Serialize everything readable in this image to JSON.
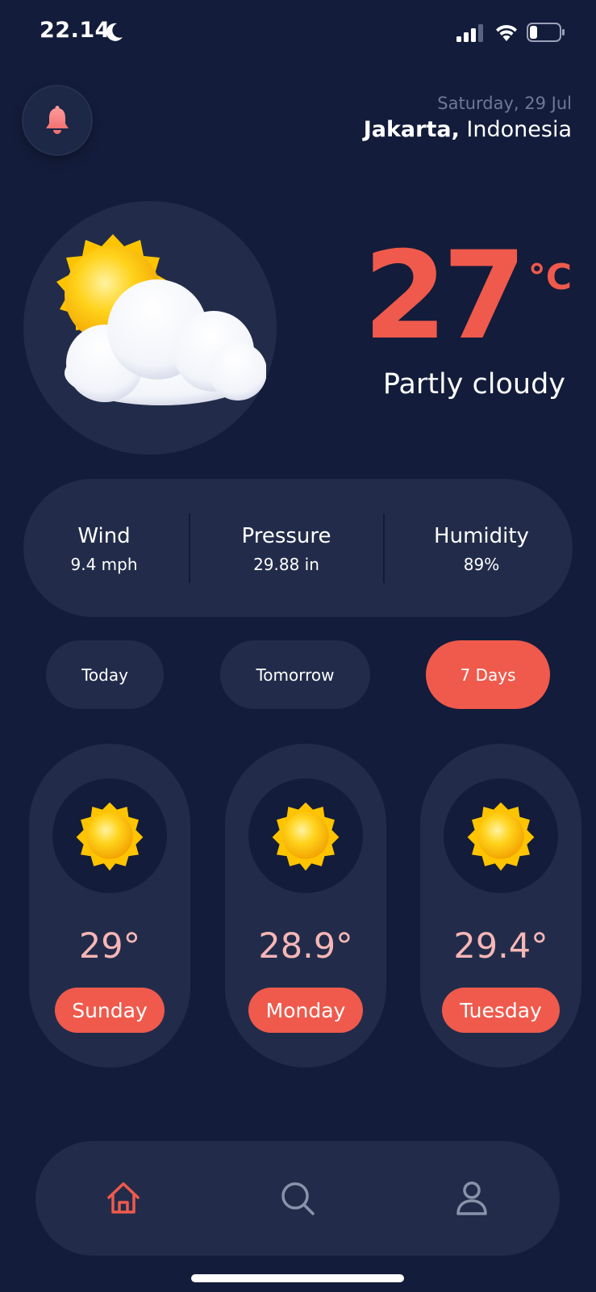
{
  "status_bar": {
    "time": "22.14",
    "icons": [
      "moon-icon",
      "signal-icon",
      "wifi-icon",
      "battery-icon"
    ]
  },
  "header": {
    "bell_icon": "bell-icon",
    "date": "Saturday, 29 Jul",
    "city": "Jakarta,",
    "country": "Indonesia"
  },
  "current": {
    "icon": "partly-cloudy-icon",
    "temperature": "27",
    "unit": "°C",
    "condition": "Partly cloudy"
  },
  "stats": [
    {
      "label": "Wind",
      "value": "9.4 mph"
    },
    {
      "label": "Pressure",
      "value": "29.88 in"
    },
    {
      "label": "Humidity",
      "value": "89%"
    }
  ],
  "tabs": [
    {
      "label": "Today",
      "active": false
    },
    {
      "label": "Tomorrow",
      "active": false
    },
    {
      "label": "7 Days",
      "active": true
    }
  ],
  "forecast": [
    {
      "icon": "sun-icon",
      "temp": "29°",
      "day": "Sunday"
    },
    {
      "icon": "sun-icon",
      "temp": "28.9°",
      "day": "Monday"
    },
    {
      "icon": "sun-icon",
      "temp": "29.4°",
      "day": "Tuesday"
    }
  ],
  "nav": [
    {
      "icon": "home-icon",
      "active": true
    },
    {
      "icon": "search-icon",
      "active": false
    },
    {
      "icon": "profile-icon",
      "active": false
    }
  ],
  "colors": {
    "background": "#131c3a",
    "card": "#222c4a",
    "accent": "#ef5a4c",
    "forecast_temp": "#f7b6b6",
    "muted_text": "#6f7896",
    "nav_inactive": "#8a92aa"
  }
}
